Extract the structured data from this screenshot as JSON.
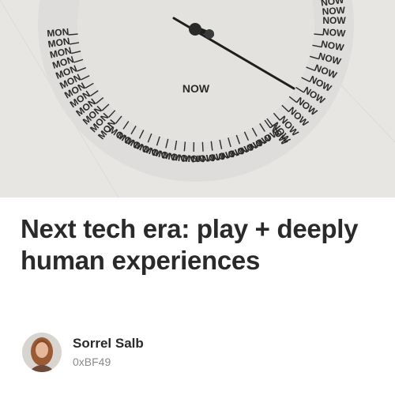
{
  "hero": {
    "clock_word": "NOW",
    "ring_words_left": "MON",
    "ring_words_right": "NOW"
  },
  "post": {
    "title": "Next tech era: play + deeply human experiences"
  },
  "author": {
    "name": "Sorrel Salb",
    "handle": "0xBF49"
  }
}
